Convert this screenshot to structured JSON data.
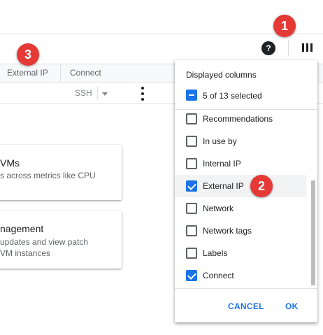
{
  "toolbar": {
    "help_icon_glyph": "?"
  },
  "table": {
    "headers": [
      "External IP",
      "Connect"
    ],
    "row": {
      "connect_value": "SSH"
    }
  },
  "cards": [
    {
      "title": "VMs",
      "lines": [
        "s across metrics like CPU"
      ]
    },
    {
      "title": "nagement",
      "lines": [
        "updates and view patch",
        "VM instances"
      ]
    }
  ],
  "annotations": {
    "badge1": "1",
    "badge2": "2",
    "badge3": "3"
  },
  "column_panel": {
    "title": "Displayed columns",
    "selection_summary": "5 of 13 selected",
    "options": [
      {
        "label": "Recommendations",
        "checked": false
      },
      {
        "label": "In use by",
        "checked": false
      },
      {
        "label": "Internal IP",
        "checked": false
      },
      {
        "label": "External IP",
        "checked": true
      },
      {
        "label": "Network",
        "checked": false
      },
      {
        "label": "Network tags",
        "checked": false
      },
      {
        "label": "Labels",
        "checked": false
      },
      {
        "label": "Connect",
        "checked": true
      }
    ],
    "cancel_label": "CANCEL",
    "ok_label": "OK"
  },
  "colors": {
    "accent": "#1a73e8",
    "badge": "#e53935"
  }
}
